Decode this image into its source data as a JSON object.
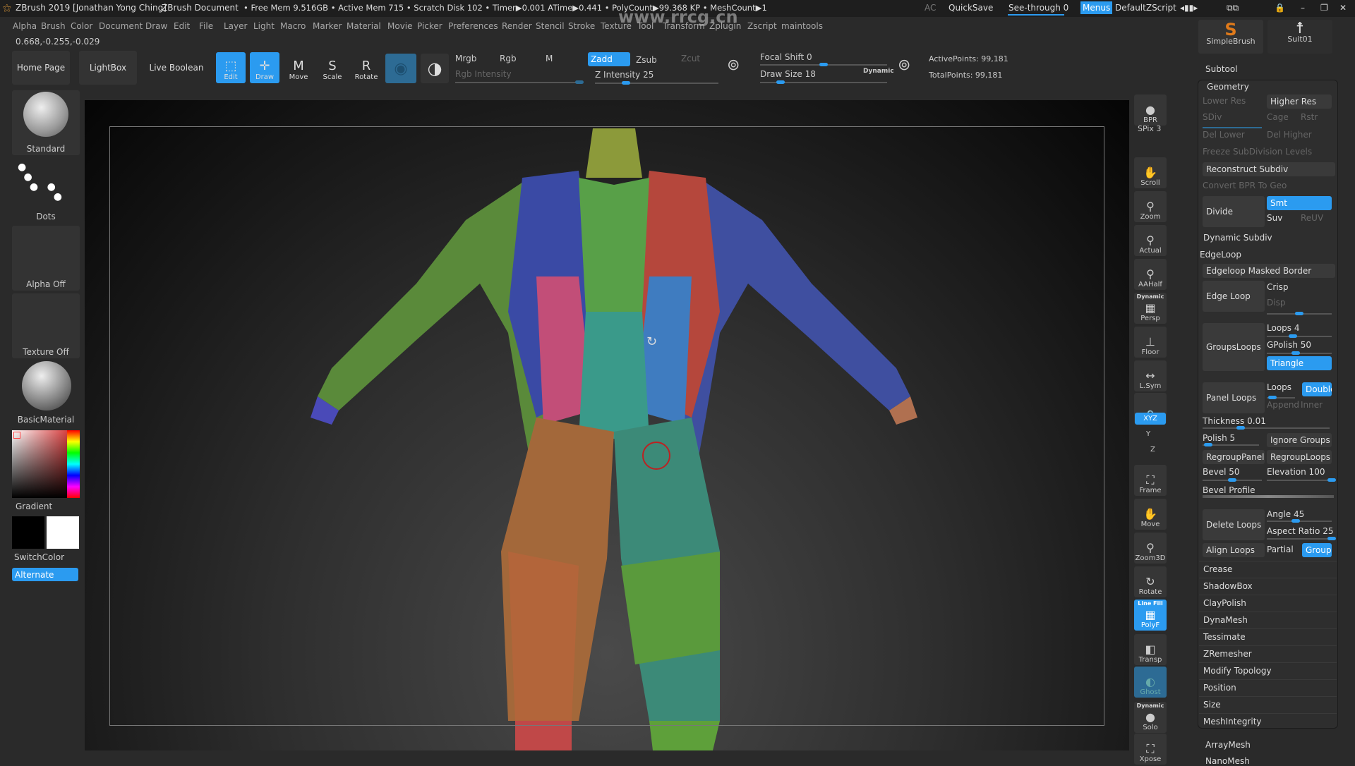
{
  "title_bar": {
    "app": "ZBrush 2019 [Jonathan Yong Ching]",
    "doc": "ZBrush Document",
    "stats": "• Free Mem 9.516GB • Active Mem 715 • Scratch Disk 102 • Timer▶0.001 ATime▶0.441 • PolyCount▶99.368 KP • MeshCount▶1",
    "ac": "AC",
    "quicksave": "QuickSave",
    "see_through": "See-through  0",
    "menus": "Menus",
    "script": "DefaultZScript",
    "watermark": "www.rrcg.cn"
  },
  "menu": [
    "Alpha",
    "Brush",
    "Color",
    "Document",
    "Draw",
    "Edit",
    "File",
    "Layer",
    "Light",
    "Macro",
    "Marker",
    "Material",
    "Movie",
    "Picker",
    "Preferences",
    "Render",
    "Stencil",
    "Stroke",
    "Texture",
    "Tool",
    "Transform",
    "Zplugin",
    "Zscript",
    "maintools"
  ],
  "coords": "0.668,-0.255,-0.029",
  "toolbar": {
    "home": "Home Page",
    "lightbox": "LightBox",
    "live_boolean": "Live Boolean",
    "edit": "Edit",
    "draw": "Draw",
    "move": "Move",
    "scale": "Scale",
    "rotate": "Rotate",
    "mrgb": "Mrgb",
    "rgb": "Rgb",
    "m": "M",
    "rgb_intensity": "Rgb Intensity",
    "zadd": "Zadd",
    "zsub": "Zsub",
    "zcut": "Zcut",
    "z_intensity": "Z Intensity 25",
    "focal_shift": "Focal Shift 0",
    "draw_size": "Draw Size 18",
    "dynamic": "Dynamic",
    "active_points": "ActivePoints: 99,181",
    "total_points": "TotalPoints: 99,181",
    "z_intensity_value": 25,
    "focal_shift_value": 0,
    "draw_size_value": 18
  },
  "tool_thumbs": {
    "simple_brush": "SimpleBrush",
    "subtool": "Suit01"
  },
  "shelf": {
    "standard": "Standard",
    "dots": "Dots",
    "alpha": "Alpha Off",
    "texture": "Texture Off",
    "material": "BasicMaterial",
    "gradient": "Gradient",
    "switch": "SwitchColor",
    "alternate": "Alternate"
  },
  "right_icons": [
    {
      "label": "BPR",
      "glyph": "●"
    },
    {
      "label": "Scroll",
      "glyph": "✋"
    },
    {
      "label": "Zoom",
      "glyph": "⚲"
    },
    {
      "label": "Actual",
      "glyph": "⚲"
    },
    {
      "label": "AAHalf",
      "glyph": "⚲"
    },
    {
      "label": "Persp",
      "glyph": "▦"
    },
    {
      "label": "Floor",
      "glyph": "⊥"
    },
    {
      "label": "L.Sym",
      "glyph": "↔"
    },
    {
      "label": "",
      "glyph": "🔒"
    },
    {
      "label": "Frame",
      "glyph": "⛶"
    },
    {
      "label": "Move",
      "glyph": "✋"
    },
    {
      "label": "Zoom3D",
      "glyph": "⚲"
    },
    {
      "label": "Rotate",
      "glyph": "↻"
    },
    {
      "label": "PolyF",
      "glyph": "▦"
    },
    {
      "label": "Transp",
      "glyph": "◧"
    },
    {
      "label": "Ghost",
      "glyph": "◐"
    },
    {
      "label": "Solo",
      "glyph": "●"
    },
    {
      "label": "Xpose",
      "glyph": "⛶"
    }
  ],
  "right_extra": {
    "spix": "SPix 3",
    "xyz": "XYZ",
    "y": "Y",
    "z": "Z",
    "dynamic": "Dynamic",
    "line_fill": "Line Fill",
    "dynamic2": "Dynamic"
  },
  "panel": {
    "subtool": "Subtool",
    "geometry": "Geometry",
    "lower_res": "Lower Res",
    "higher_res": "Higher Res",
    "sdiv": "SDiv",
    "cage": "Cage",
    "rstr": "Rstr",
    "del_lower": "Del Lower",
    "del_higher": "Del Higher",
    "freeze": "Freeze SubDivision Levels",
    "reconstruct": "Reconstruct Subdiv",
    "convert_bpr": "Convert BPR To Geo",
    "divide": "Divide",
    "smt": "Smt",
    "suv": "Suv",
    "reuv": "ReUV",
    "dynamic_subdiv": "Dynamic Subdiv",
    "edgeloop": "EdgeLoop",
    "masked_border": "Edgeloop Masked Border",
    "edge_loop": "Edge Loop",
    "crisp": "Crisp",
    "disp": "Disp",
    "groups_loops": "GroupsLoops",
    "loops4": "Loops 4",
    "gpolish": "GPolish 50",
    "triangle": "Triangle",
    "panel_loops": "Panel Loops",
    "loops": "Loops",
    "double": "Double",
    "append": "Append",
    "inner": "Inner",
    "thickness": "Thickness 0.01",
    "polish": "Polish 5",
    "ignore_groups": "Ignore Groups",
    "regroup_panels": "RegroupPanels",
    "regroup_loops": "RegroupLoops",
    "bevel": "Bevel 50",
    "elevation": "Elevation 100",
    "bevel_profile": "Bevel Profile",
    "delete_loops": "Delete Loops",
    "angle": "Angle 45",
    "aspect": "Aspect Ratio 25",
    "align_loops": "Align Loops",
    "partial": "Partial",
    "groups": "Groups",
    "sections": [
      "Crease",
      "ShadowBox",
      "ClayPolish",
      "DynaMesh",
      "Tessimate",
      "ZRemesher",
      "Modify Topology",
      "Position",
      "Size",
      "MeshIntegrity"
    ],
    "array_mesh": "ArrayMesh",
    "nano_mesh": "NanoMesh"
  },
  "colors": {
    "accent": "#2b9bf0"
  }
}
